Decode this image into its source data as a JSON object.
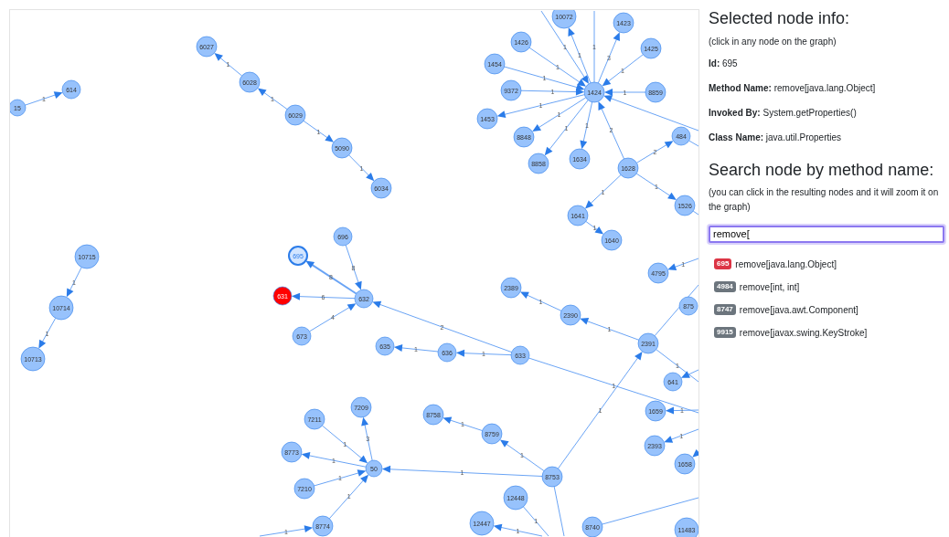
{
  "graph": {
    "nodes": [
      {
        "label": "15",
        "selected": false,
        "color": "#97c2fc"
      },
      {
        "label": "614",
        "selected": false,
        "color": "#97c2fc"
      },
      {
        "label": "6027",
        "selected": false,
        "color": "#97c2fc"
      },
      {
        "label": "6028",
        "selected": false,
        "color": "#97c2fc"
      },
      {
        "label": "6029",
        "selected": false,
        "color": "#97c2fc"
      },
      {
        "label": "5090",
        "selected": false,
        "color": "#97c2fc"
      },
      {
        "label": "6034",
        "selected": false,
        "color": "#97c2fc"
      },
      {
        "label": "10715",
        "selected": false,
        "color": "#97c2fc"
      },
      {
        "label": "10714",
        "selected": false,
        "color": "#97c2fc"
      },
      {
        "label": "10713",
        "selected": false,
        "color": "#97c2fc"
      },
      {
        "label": "696",
        "selected": false,
        "color": "#97c2fc"
      },
      {
        "label": "695",
        "selected": true,
        "color": "#d2e5ff"
      },
      {
        "label": "632",
        "selected": false,
        "color": "#97c2fc"
      },
      {
        "label": "631",
        "selected": false,
        "color": "#ff0000"
      },
      {
        "label": "673",
        "selected": false,
        "color": "#97c2fc"
      },
      {
        "label": "635",
        "selected": false,
        "color": "#97c2fc"
      },
      {
        "label": "636",
        "selected": false,
        "color": "#97c2fc"
      },
      {
        "label": "633",
        "selected": false,
        "color": "#97c2fc"
      },
      {
        "label": "7209",
        "selected": false,
        "color": "#97c2fc"
      },
      {
        "label": "7211",
        "selected": false,
        "color": "#97c2fc"
      },
      {
        "label": "8773",
        "selected": false,
        "color": "#97c2fc"
      },
      {
        "label": "7210",
        "selected": false,
        "color": "#97c2fc"
      },
      {
        "label": "50",
        "selected": false,
        "color": "#97c2fc"
      },
      {
        "label": "8774",
        "selected": false,
        "color": "#97c2fc"
      },
      {
        "label": "8758",
        "selected": false,
        "color": "#97c2fc"
      },
      {
        "label": "8759",
        "selected": false,
        "color": "#97c2fc"
      },
      {
        "label": "8753",
        "selected": false,
        "color": "#97c2fc"
      },
      {
        "label": "12448",
        "selected": false,
        "color": "#97c2fc"
      },
      {
        "label": "12447",
        "selected": false,
        "color": "#97c2fc"
      },
      {
        "label": "8740",
        "selected": false,
        "color": "#97c2fc"
      },
      {
        "label": "11483",
        "selected": false,
        "color": "#97c2fc"
      },
      {
        "label": "2389",
        "selected": false,
        "color": "#97c2fc"
      },
      {
        "label": "2390",
        "selected": false,
        "color": "#97c2fc"
      },
      {
        "label": "2391",
        "selected": false,
        "color": "#97c2fc"
      },
      {
        "label": "4795",
        "selected": false,
        "color": "#97c2fc"
      },
      {
        "label": "875",
        "selected": false,
        "color": "#97c2fc"
      },
      {
        "label": "641",
        "selected": false,
        "color": "#97c2fc"
      },
      {
        "label": "1659",
        "selected": false,
        "color": "#97c2fc"
      },
      {
        "label": "2393",
        "selected": false,
        "color": "#97c2fc"
      },
      {
        "label": "1658",
        "selected": false,
        "color": "#97c2fc"
      },
      {
        "label": "1424",
        "selected": false,
        "color": "#97c2fc"
      },
      {
        "label": "10072",
        "selected": false,
        "color": "#97c2fc"
      },
      {
        "label": "1423",
        "selected": false,
        "color": "#97c2fc"
      },
      {
        "label": "1426",
        "selected": false,
        "color": "#97c2fc"
      },
      {
        "label": "1425",
        "selected": false,
        "color": "#97c2fc"
      },
      {
        "label": "1454",
        "selected": false,
        "color": "#97c2fc"
      },
      {
        "label": "9372",
        "selected": false,
        "color": "#97c2fc"
      },
      {
        "label": "8859",
        "selected": false,
        "color": "#97c2fc"
      },
      {
        "label": "1453",
        "selected": false,
        "color": "#97c2fc"
      },
      {
        "label": "8848",
        "selected": false,
        "color": "#97c2fc"
      },
      {
        "label": "8858",
        "selected": false,
        "color": "#97c2fc"
      },
      {
        "label": "1634",
        "selected": false,
        "color": "#97c2fc"
      },
      {
        "label": "484",
        "selected": false,
        "color": "#97c2fc"
      },
      {
        "label": "1628",
        "selected": false,
        "color": "#97c2fc"
      },
      {
        "label": "1641",
        "selected": false,
        "color": "#97c2fc"
      },
      {
        "label": "1526",
        "selected": false,
        "color": "#97c2fc"
      },
      {
        "label": "1640",
        "selected": false,
        "color": "#97c2fc"
      }
    ],
    "edge_labels": [
      "1",
      "1",
      "1",
      "1",
      "1",
      "1",
      "1",
      "8",
      "8",
      "6",
      "4",
      "2",
      "1",
      "1",
      "1",
      "1",
      "1",
      "1",
      "1",
      "1",
      "1",
      "1",
      "1",
      "1",
      "1",
      "3",
      "1",
      "1",
      "1",
      "1",
      "1",
      "1",
      "1",
      "1",
      "1",
      "1",
      "3",
      "1",
      "1",
      "1",
      "1",
      "1",
      "1",
      "1",
      "1",
      "1",
      "2",
      "2",
      "1",
      "1",
      "1"
    ]
  },
  "selected_info": {
    "title": "Selected node info:",
    "hint": "(click in any node on the graph)",
    "lines": [
      "**Id:** 695",
      "**Method Name:** remove[java.lang.Object]",
      "**Invoked By:** System.getProperties()",
      "**Class Name:** java.util.Properties"
    ]
  },
  "search": {
    "title": "Search node by method name:",
    "hint": "(you can click in the resulting nodes and it will zoom it on the graph)",
    "value": "remove[",
    "results": [
      {
        "id": "695",
        "text": "remove[java.lang.Object]",
        "color": "#dc3545"
      },
      {
        "id": "4984",
        "text": "remove[int, int]",
        "color": "#6c757d"
      },
      {
        "id": "8747",
        "text": "remove[java.awt.Component]",
        "color": "#6c757d"
      },
      {
        "id": "9915",
        "text": "remove[javax.swing.KeyStroke]",
        "color": "#6c757d"
      }
    ]
  }
}
